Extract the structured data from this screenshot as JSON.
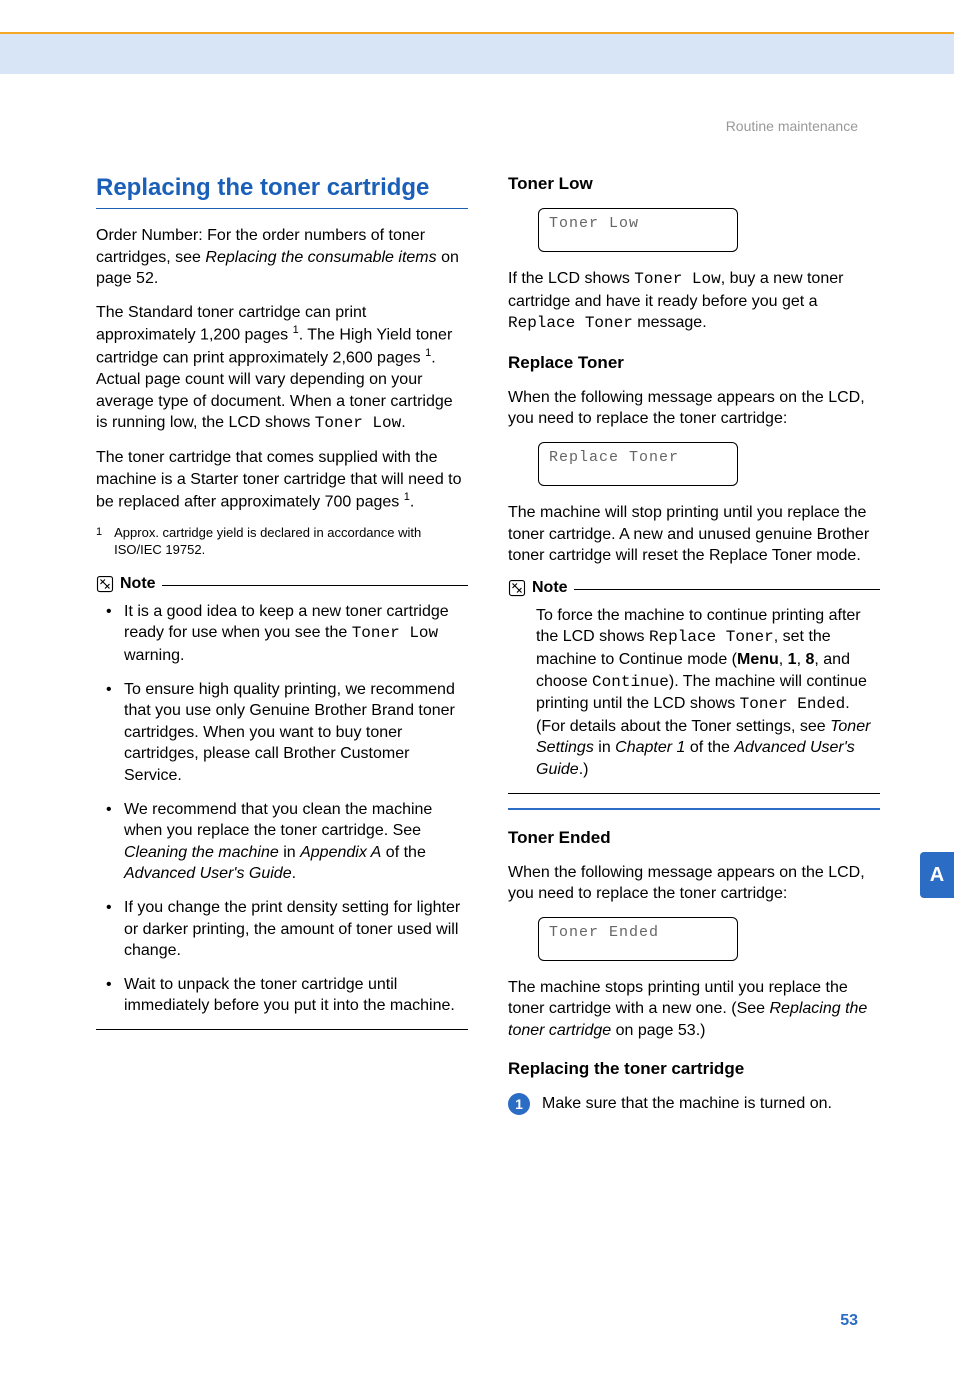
{
  "header": {
    "section": "Routine maintenance"
  },
  "left": {
    "title": "Replacing the toner cartridge",
    "p1_a": "Order Number: For the order numbers of toner cartridges, see ",
    "p1_link": "Replacing the consumable items",
    "p1_b": " on page 52.",
    "p2_a": "The Standard toner cartridge can print approximately 1,200 pages ",
    "p2_sup1": "1",
    "p2_b": ". The High Yield toner cartridge can print approximately 2,600 pages ",
    "p2_sup2": "1",
    "p2_c": ". Actual page count will vary depending on your average type of document. When a toner cartridge is running low, the LCD shows ",
    "p2_code": "Toner Low",
    "p2_d": ".",
    "p3_a": "The toner cartridge that comes supplied with the machine is a Starter toner cartridge that will need to be replaced after approximately 700 pages ",
    "p3_sup": "1",
    "p3_b": ".",
    "footnote_num": "1",
    "footnote": "Approx. cartridge yield is declared in accordance with ISO/IEC 19752.",
    "note_label": "Note",
    "note_items": {
      "i1_a": "It is a good idea to keep a new toner cartridge ready for use when you see the ",
      "i1_code": "Toner Low",
      "i1_b": " warning.",
      "i2": "To ensure high quality printing, we recommend that you use only Genuine Brother Brand toner cartridges. When you want to buy toner cartridges, please call Brother Customer Service.",
      "i3_a": "We recommend that you clean the machine when you replace the toner cartridge. See ",
      "i3_it1": "Cleaning the machine",
      "i3_b": " in ",
      "i3_it2": "Appendix A",
      "i3_c": " of the ",
      "i3_it3": "Advanced User's Guide",
      "i3_d": ".",
      "i4": "If you change the print density setting for lighter or darker printing, the amount of toner used will change.",
      "i5": "Wait to unpack the toner cartridge until immediately before you put it into the machine."
    }
  },
  "right": {
    "s1": {
      "heading": "Toner Low",
      "lcd": "Toner Low",
      "p_a": "If the LCD shows ",
      "p_code1": "Toner Low",
      "p_b": ", buy a new toner cartridge and have it ready before you get a ",
      "p_code2": "Replace Toner",
      "p_c": " message."
    },
    "s2": {
      "heading": "Replace Toner",
      "p1": "When the following message appears on the LCD, you need to replace the toner cartridge:",
      "lcd": "Replace Toner",
      "p2": "The machine will stop printing until you replace the toner cartridge. A new and unused genuine Brother toner cartridge will reset the Replace Toner mode.",
      "note_label": "Note",
      "note_a": "To force the machine to continue printing after the LCD shows ",
      "note_code1": "Replace Toner",
      "note_b": ", set the machine to Continue mode (",
      "note_bold1": "Menu",
      "note_c": ", ",
      "note_bold2": "1",
      "note_d": ", ",
      "note_bold3": "8",
      "note_e": ", and choose ",
      "note_code2": "Continue",
      "note_f": "). The machine will continue printing until the LCD shows ",
      "note_code3": "Toner Ended",
      "note_g": ". (For details about the Toner settings, see ",
      "note_it1": "Toner Settings",
      "note_h": " in ",
      "note_it2": "Chapter 1",
      "note_i": " of the ",
      "note_it3": "Advanced User's Guide",
      "note_j": ".)"
    },
    "s3": {
      "heading": "Toner Ended",
      "p1": "When the following message appears on the LCD, you need to replace the toner cartridge:",
      "lcd": "Toner Ended",
      "p2_a": "The machine stops printing until you replace the toner cartridge with a new one. (See ",
      "p2_it": "Replacing the toner cartridge",
      "p2_b": " on page 53.)"
    },
    "s4": {
      "heading": "Replacing the toner cartridge",
      "step_num": "1",
      "step_text": "Make sure that the machine is turned on."
    }
  },
  "side_tab": "A",
  "page_number": "53"
}
